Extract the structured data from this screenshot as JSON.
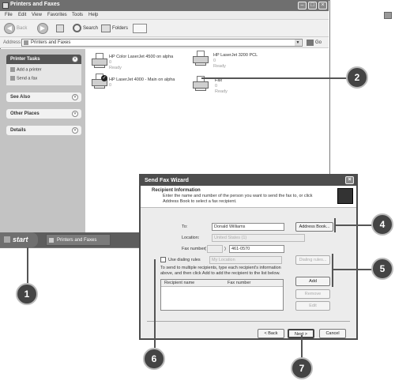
{
  "window": {
    "title": "Printers and Faxes"
  },
  "menu": [
    "File",
    "Edit",
    "View",
    "Favorites",
    "Tools",
    "Help"
  ],
  "toolbar": {
    "back": "Back",
    "search": "Search",
    "folders": "Folders"
  },
  "address": {
    "label": "Address",
    "value": "Printers and Faxes",
    "go": "Go"
  },
  "sidebar": {
    "printer_tasks": {
      "title": "Printer Tasks",
      "items": [
        "Add a printer",
        "Send a fax"
      ]
    },
    "see_also": "See Also",
    "other_places": "Other Places",
    "details": "Details"
  },
  "printers": [
    {
      "name": "HP Color LaserJet 4500 on alpha",
      "count": "0",
      "status": "Ready"
    },
    {
      "name": "HP LaserJet 3200 PCL",
      "count": "0",
      "status": "Ready"
    },
    {
      "name": "HP LaserJet 4000 - Main on alpha",
      "count": "0",
      "status": ""
    },
    {
      "name": "Fax",
      "count": "0",
      "status": "Ready"
    }
  ],
  "taskbar": {
    "start": "start",
    "item": "Printers and Faxes"
  },
  "dialog": {
    "title": "Send Fax Wizard",
    "heading": "Recipient Information",
    "description": "Enter the name and number of the person you want to send the fax to, or click Address Book to select a fax recipient.",
    "to_label": "To:",
    "to_value": "Donald Williams",
    "address_book": "Address Book...",
    "location_label": "Location:",
    "location_value": "United States (1)",
    "fax_label": "Fax number:",
    "fax_open": "(",
    "fax_close": ")",
    "fax_value": "461-0570",
    "dialing_rules_check": "Use dialing rules",
    "dialing_location": "My Location",
    "dialing_rules_btn": "Dialing rules...",
    "multi_text": "To send to multiple recipients, type each recipient's information above, and then click Add to add the recipient to the list below.",
    "add": "Add",
    "col_name": "Recipient name",
    "col_fax": "Fax number",
    "remove": "Remove",
    "edit": "Edit",
    "back": "< Back",
    "next": "Next >",
    "cancel": "Cancel"
  },
  "callouts": [
    "1",
    "2",
    "4",
    "5",
    "6",
    "7"
  ],
  "colors": {
    "title": "#6f6f6f",
    "sidebar": "#c3c3c3",
    "callout": "#444444"
  }
}
